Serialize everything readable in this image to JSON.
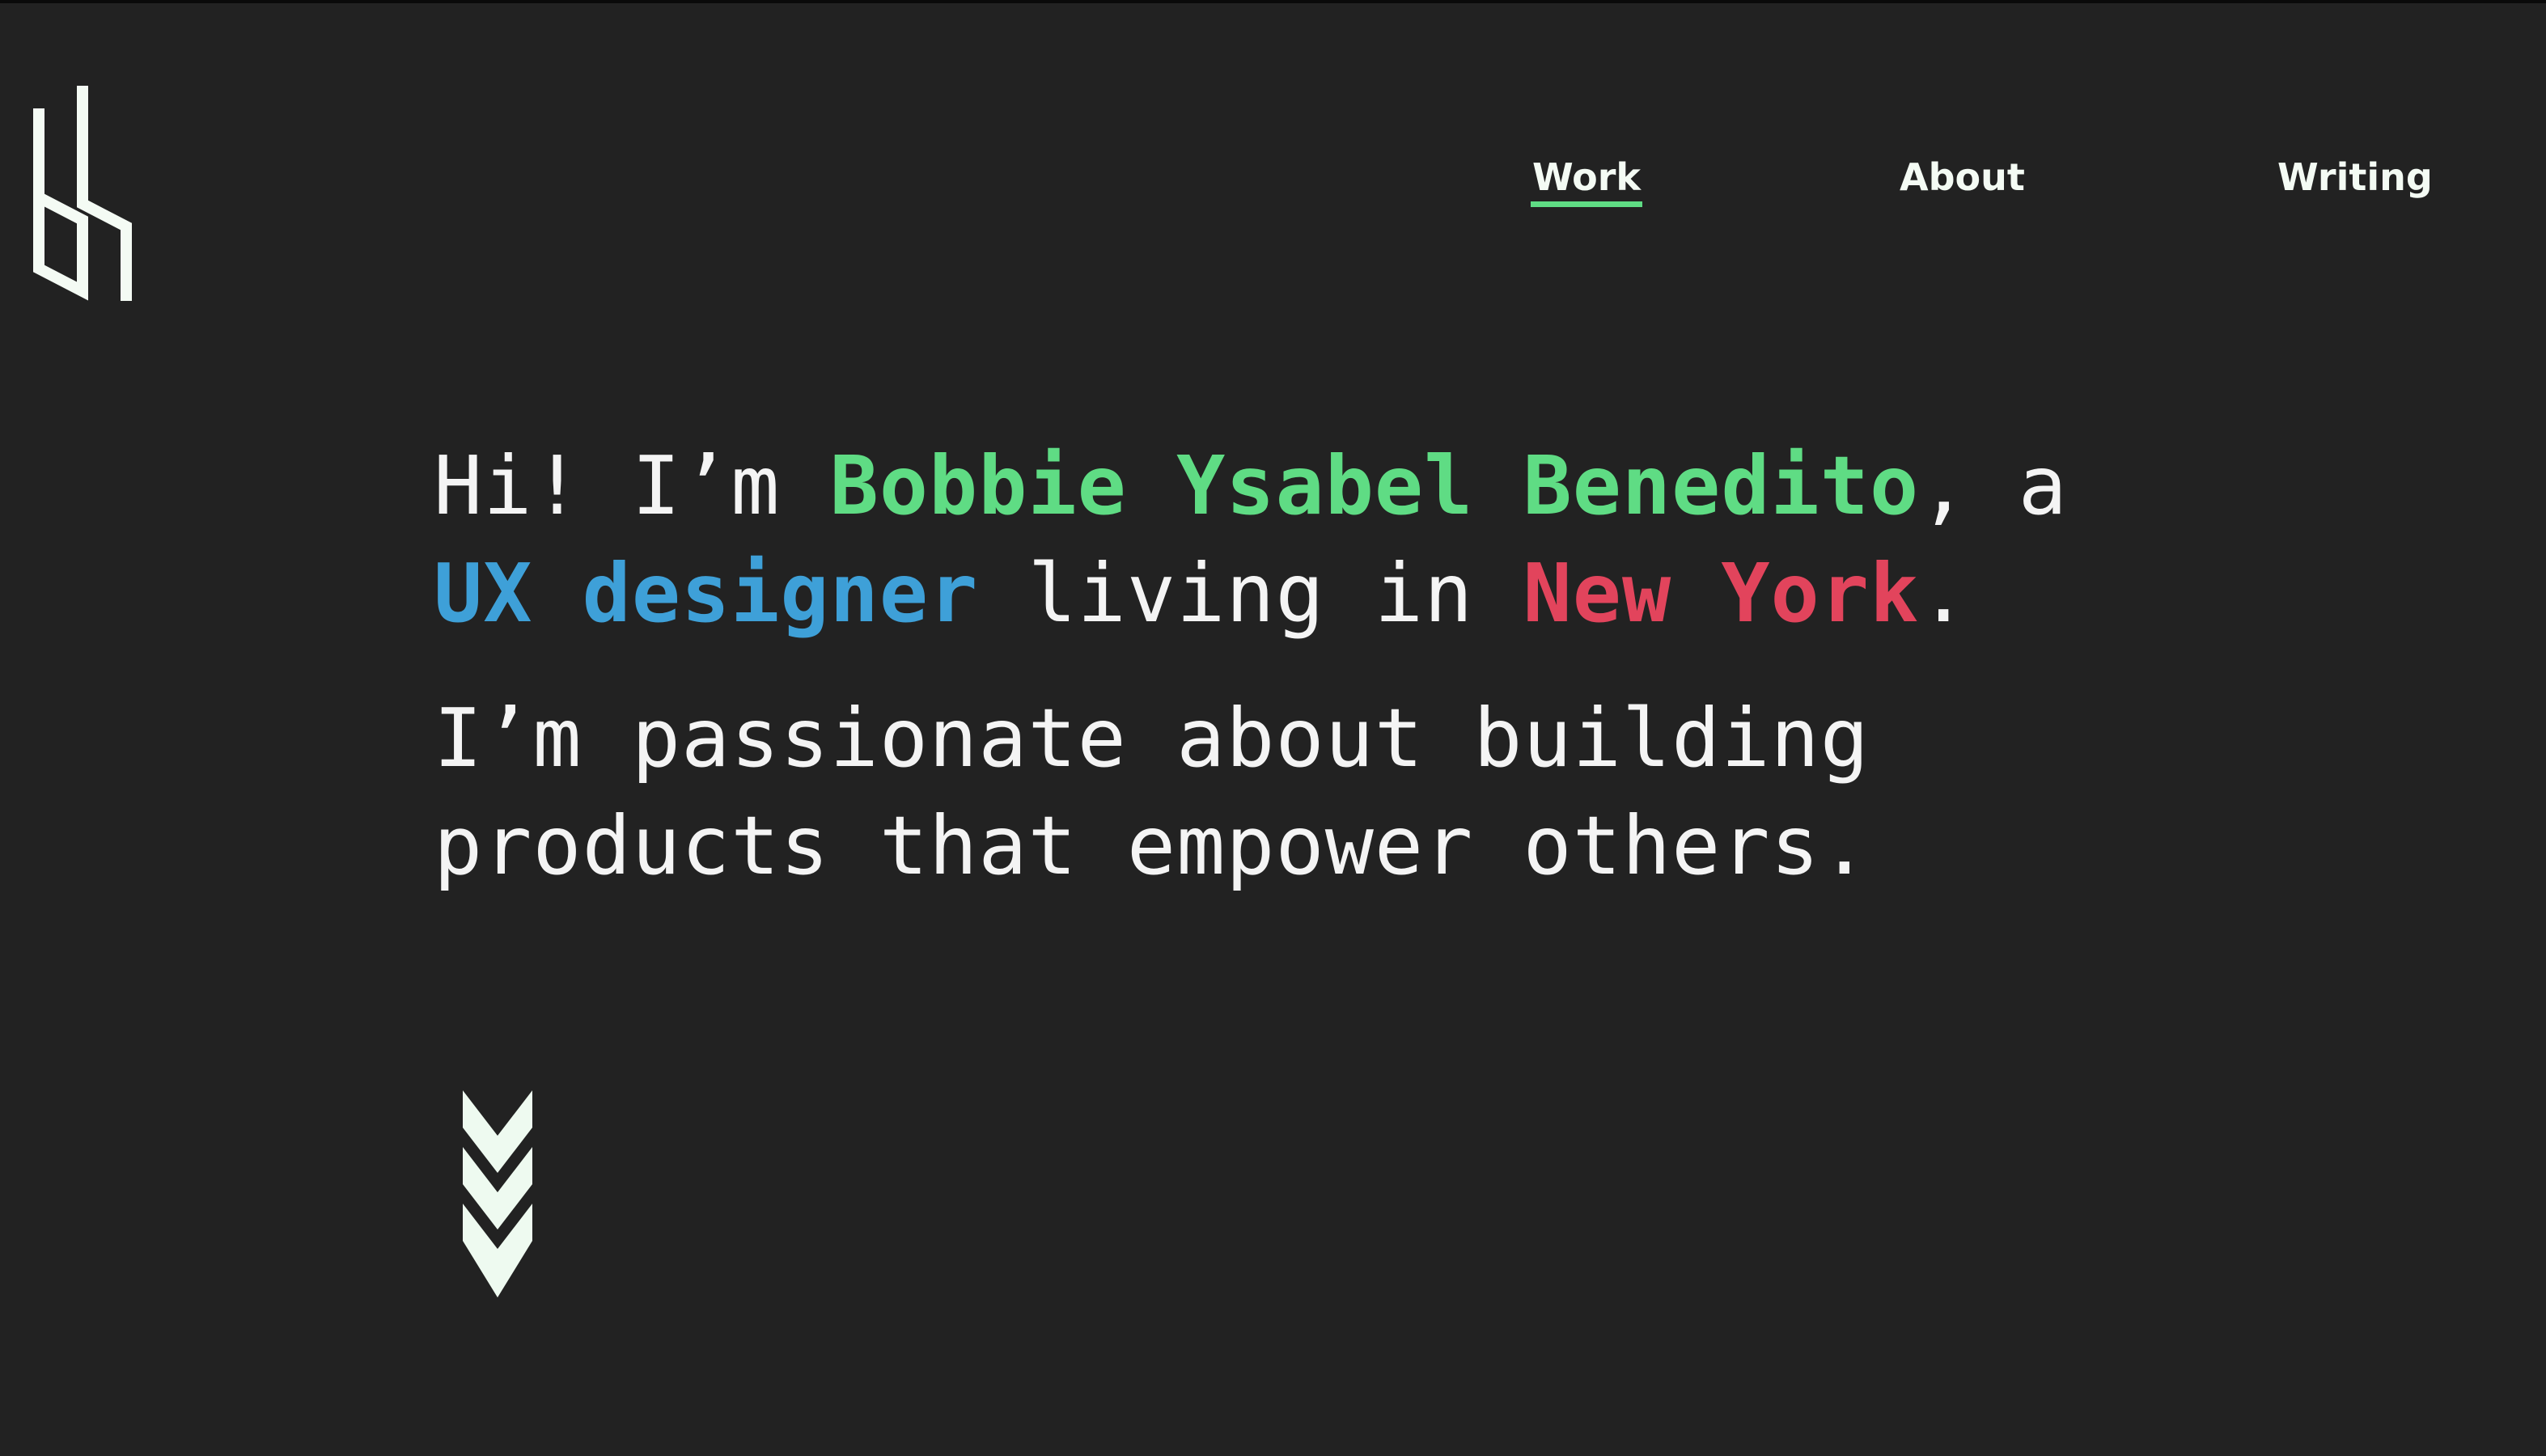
{
  "logo": {
    "icon": "by-monogram-logo",
    "color": "#f4fbf4"
  },
  "nav": {
    "items": [
      {
        "label": "Work",
        "active": true
      },
      {
        "label": "About",
        "active": false
      },
      {
        "label": "Writing",
        "active": false
      }
    ],
    "active_underline_color": "#5fdc84"
  },
  "hero": {
    "line1": {
      "prefix": "Hi! I’m ",
      "name": "Bobbie Ysabel Benedito",
      "suffix": ", a"
    },
    "line2": {
      "role": "UX designer",
      "middle": " living in ",
      "city": "New York",
      "end": "."
    },
    "tagline_line1": "I’m passionate about building",
    "tagline_line2": "products that empower others."
  },
  "colors": {
    "background": "#222222",
    "text": "#f4f4f4",
    "name": "#5fdc84",
    "role": "#3ea0d8",
    "city": "#e2445c"
  },
  "scroll_indicator": {
    "icon": "triple-chevron-down-icon"
  }
}
